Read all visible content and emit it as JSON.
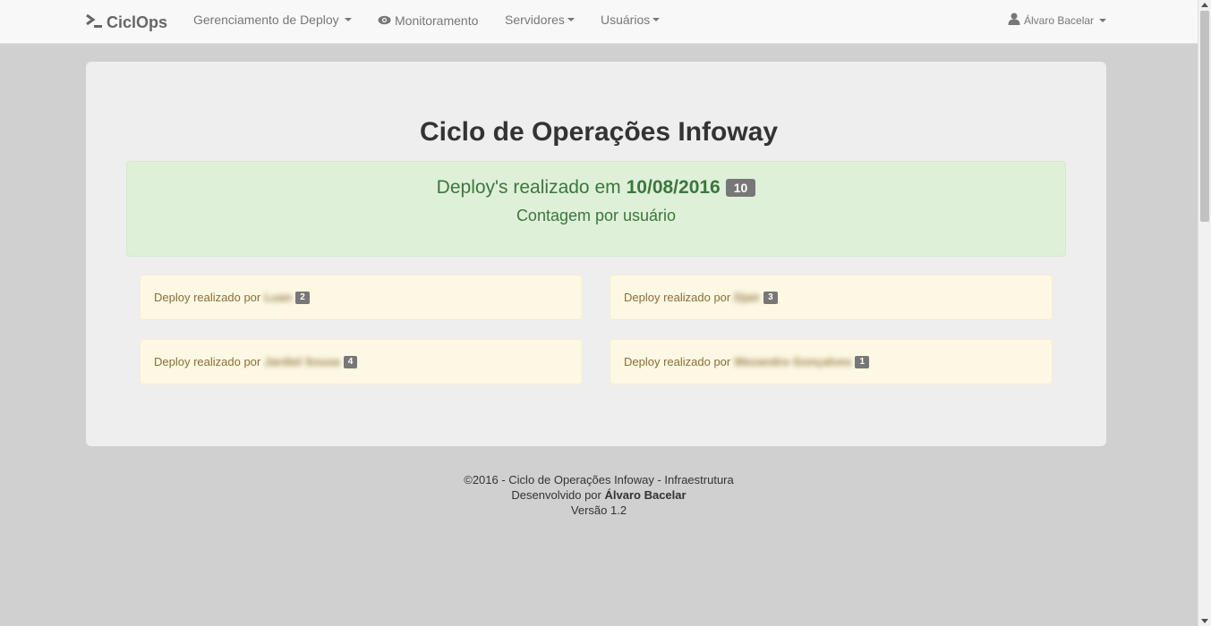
{
  "navbar": {
    "brand": "CiclOps",
    "brand_icon": ">_",
    "items": [
      {
        "label": "Gerenciamento de Deploy",
        "icon": "chevron-down-icon"
      },
      {
        "label": "Monitoramento",
        "icon": "eye-icon"
      },
      {
        "label": "Servidores",
        "icon": "chevron-down-icon"
      },
      {
        "label": "Usuários",
        "icon": "chevron-down-icon"
      }
    ],
    "user": {
      "label": "Álvaro Bacelar",
      "icon": "user-icon"
    }
  },
  "main": {
    "title": "Ciclo de Operações Infoway",
    "summary": {
      "prefix": "Deploy's realizado em",
      "date": "10/08/2016",
      "total": "10",
      "subtitle": "Contagem por usuário"
    },
    "cards": [
      {
        "label": "Deploy realizado por",
        "user": "Luan",
        "count": "2"
      },
      {
        "label": "Deploy realizado por",
        "user": "Djair",
        "count": "3"
      },
      {
        "label": "Deploy realizado por",
        "user": "Jardiel Sousa",
        "count": "4"
      },
      {
        "label": "Deploy realizado por",
        "user": "Wezandro Gonçalves",
        "count": "1"
      }
    ]
  },
  "footer": {
    "line1": "©2016 - Ciclo de Operações Infoway - Infraestrutura",
    "line2_prefix": "Desenvolvido por",
    "line2_author": "Álvaro Bacelar",
    "line3": "Versão 1.2"
  },
  "colors": {
    "success_bg": "#dff0d8",
    "success_text": "#3c763d",
    "warning_bg": "#fcf8e3",
    "warning_text": "#8a6d3b",
    "badge": "#777777"
  }
}
